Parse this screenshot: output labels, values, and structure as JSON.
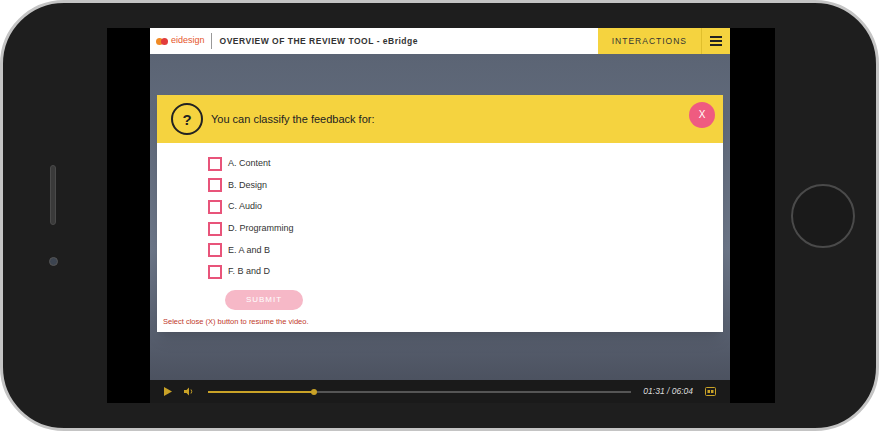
{
  "header": {
    "logo": "eidesign",
    "title": "OVERVIEW OF THE REVIEW TOOL - eBridge",
    "menu_button": "INTERACTIONS"
  },
  "question": {
    "icon": "?",
    "text": "You can classify the feedback for:",
    "close": "X",
    "options": [
      {
        "label": "A. Content",
        "checked": false
      },
      {
        "label": "B. Design",
        "checked": false
      },
      {
        "label": "C. Audio",
        "checked": false
      },
      {
        "label": "D. Programming",
        "checked": false
      },
      {
        "label": "E. A and B",
        "checked": false
      },
      {
        "label": "F. B and D",
        "checked": false
      }
    ],
    "submit": {
      "label": "SUBMIT",
      "disabled": true
    },
    "note": "Select close (X) button to resume the video."
  },
  "player": {
    "time": "01:31 / 06:04",
    "level": 0.25,
    "playing": false
  }
}
